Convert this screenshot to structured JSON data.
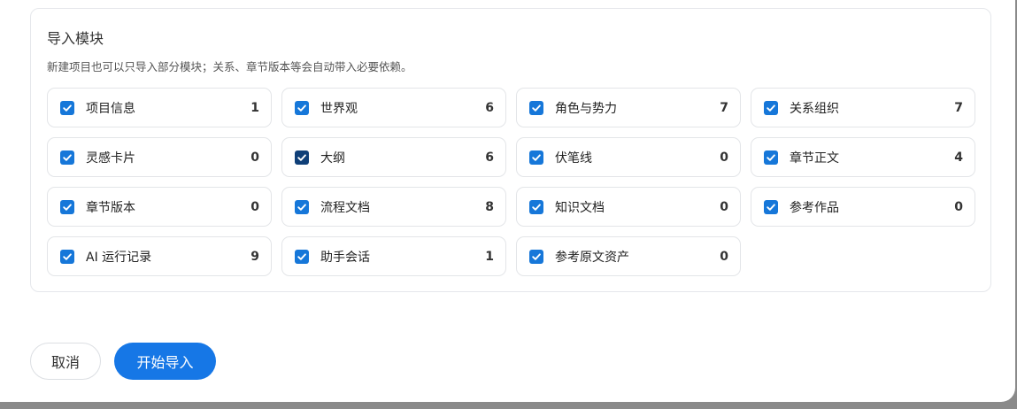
{
  "section": {
    "title": "导入模块",
    "description": "新建项目也可以只导入部分模块；关系、章节版本等会自动带入必要依赖。"
  },
  "modules": [
    {
      "label": "项目信息",
      "count": "1",
      "checked": true
    },
    {
      "label": "世界观",
      "count": "6",
      "checked": true
    },
    {
      "label": "角色与势力",
      "count": "7",
      "checked": true
    },
    {
      "label": "关系组织",
      "count": "7",
      "checked": true
    },
    {
      "label": "灵感卡片",
      "count": "0",
      "checked": true
    },
    {
      "label": "大纲",
      "count": "6",
      "checked": true,
      "focused": true
    },
    {
      "label": "伏笔线",
      "count": "0",
      "checked": true
    },
    {
      "label": "章节正文",
      "count": "4",
      "checked": true
    },
    {
      "label": "章节版本",
      "count": "0",
      "checked": true
    },
    {
      "label": "流程文档",
      "count": "8",
      "checked": true
    },
    {
      "label": "知识文档",
      "count": "0",
      "checked": true
    },
    {
      "label": "参考作品",
      "count": "0",
      "checked": true
    },
    {
      "label": "AI 运行记录",
      "count": "9",
      "checked": true
    },
    {
      "label": "助手会话",
      "count": "1",
      "checked": true
    },
    {
      "label": "参考原文资产",
      "count": "0",
      "checked": true
    }
  ],
  "footer": {
    "cancel_label": "取消",
    "start_label": "开始导入"
  },
  "colors": {
    "primary": "#1677e6",
    "checkbox": "#1677d9",
    "checkbox_focused": "#0f3f78",
    "backdrop": "#8a8a8a"
  }
}
